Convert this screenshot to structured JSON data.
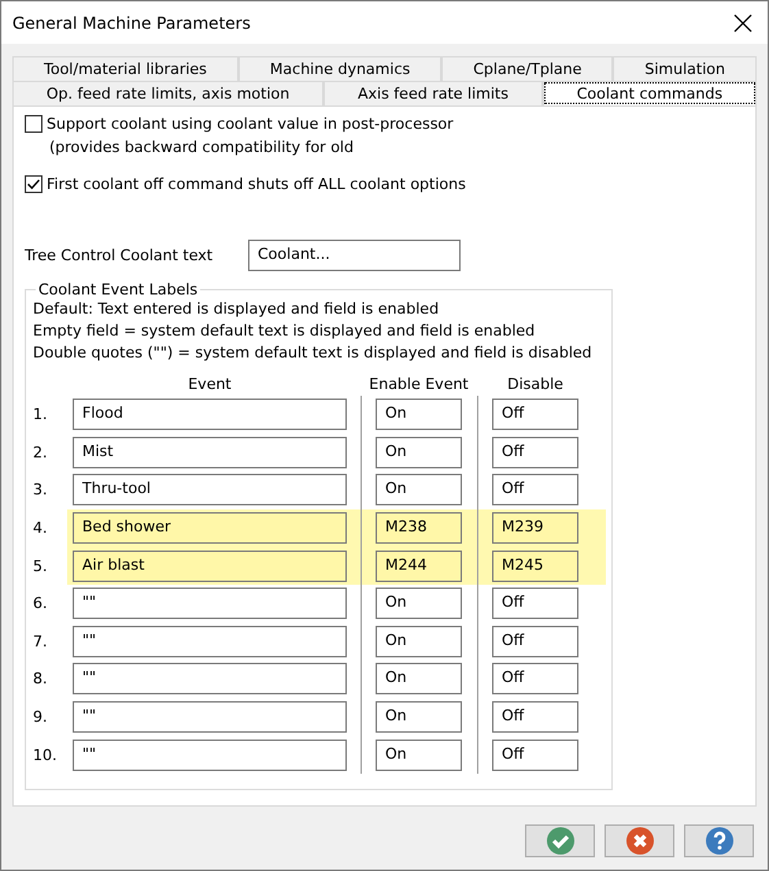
{
  "window": {
    "title": "General Machine Parameters"
  },
  "tab_rows": [
    [
      {
        "label": "Tool/material libraries",
        "selected": false
      },
      {
        "label": "Machine dynamics",
        "selected": false
      },
      {
        "label": "Cplane/Tplane",
        "selected": false
      },
      {
        "label": "Simulation",
        "selected": false
      }
    ],
    [
      {
        "label": "Op. feed rate limits, axis motion",
        "selected": false
      },
      {
        "label": "Axis feed rate limits",
        "selected": false
      },
      {
        "label": "Coolant commands",
        "selected": true
      }
    ]
  ],
  "options": [
    {
      "label": "Support coolant using coolant value in post-processor",
      "note": "(provides backward compatibility for old",
      "checked": false
    },
    {
      "label": "First coolant off command shuts off ALL coolant options",
      "checked": true
    }
  ],
  "tree_text": {
    "label": "Tree Control Coolant text",
    "value": "Coolant..."
  },
  "group": {
    "title": "Coolant Event Labels",
    "notes": [
      "Default: Text entered is displayed and field is enabled",
      "Empty field = system default text is displayed and field is enabled",
      "Double quotes (\"\") =  system default text is displayed and field is disabled"
    ],
    "columns": [
      "Event",
      "Enable Event",
      "Disable"
    ],
    "rows": [
      {
        "number": "1.",
        "event": "Flood",
        "enable": "On",
        "disable": "Off",
        "highlighted": false
      },
      {
        "number": "2.",
        "event": "Mist",
        "enable": "On",
        "disable": "Off",
        "highlighted": false
      },
      {
        "number": "3.",
        "event": "Thru-tool",
        "enable": "On",
        "disable": "Off",
        "highlighted": false
      },
      {
        "number": "4.",
        "event": "Bed shower",
        "enable": "M238",
        "disable": "M239",
        "highlighted": true
      },
      {
        "number": "5.",
        "event": "Air blast",
        "enable": "M244",
        "disable": "M245",
        "highlighted": true
      },
      {
        "number": "6.",
        "event": "\"\"",
        "enable": "On",
        "disable": "Off",
        "highlighted": false
      },
      {
        "number": "7.",
        "event": "\"\"",
        "enable": "On",
        "disable": "Off",
        "highlighted": false
      },
      {
        "number": "8.",
        "event": "\"\"",
        "enable": "On",
        "disable": "Off",
        "highlighted": false
      },
      {
        "number": "9.",
        "event": "\"\"",
        "enable": "On",
        "disable": "Off",
        "highlighted": false
      },
      {
        "number": "10.",
        "event": "\"\"",
        "enable": "On",
        "disable": "Off",
        "highlighted": false
      }
    ]
  },
  "buttons": [
    {
      "kind": "ok"
    },
    {
      "kind": "cancel"
    },
    {
      "kind": "help"
    }
  ]
}
